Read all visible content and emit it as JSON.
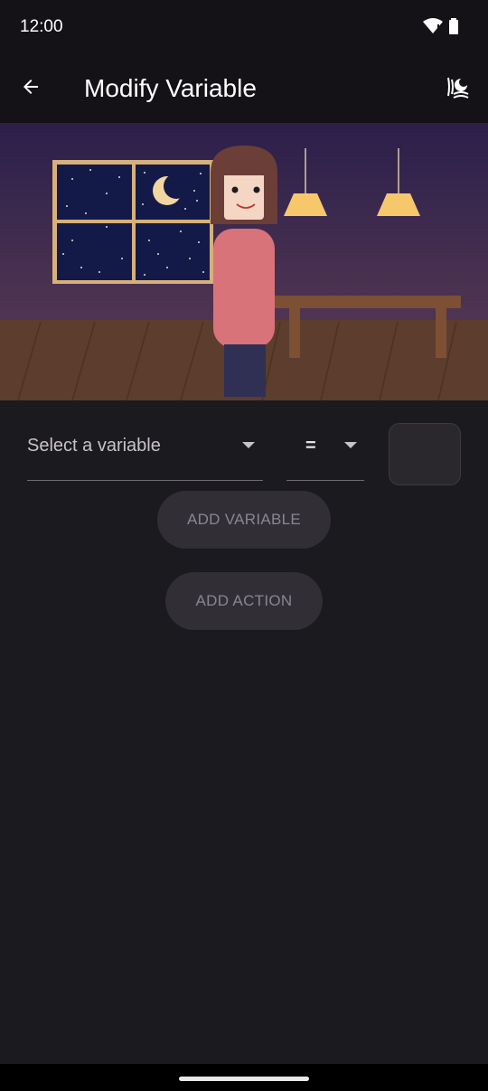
{
  "status_bar": {
    "time": "12:00",
    "icons": [
      "wifi-icon",
      "battery-icon"
    ]
  },
  "app_bar": {
    "title": "Modify Variable",
    "back_icon": "arrow-left-icon",
    "action_icon": "scene-icon"
  },
  "scene": {
    "description_icons": [
      "window",
      "moon",
      "stars",
      "lamp",
      "table",
      "character"
    ]
  },
  "form": {
    "variable_placeholder": "Select a variable",
    "operator_value": "=",
    "value_box": ""
  },
  "buttons": {
    "add_variable": "ADD VARIABLE",
    "add_action": "ADD ACTION"
  },
  "colors": {
    "background": "#1b1a1f",
    "app_bar": "#141217",
    "button_bg": "#312f35",
    "button_text": "#8a8590"
  }
}
